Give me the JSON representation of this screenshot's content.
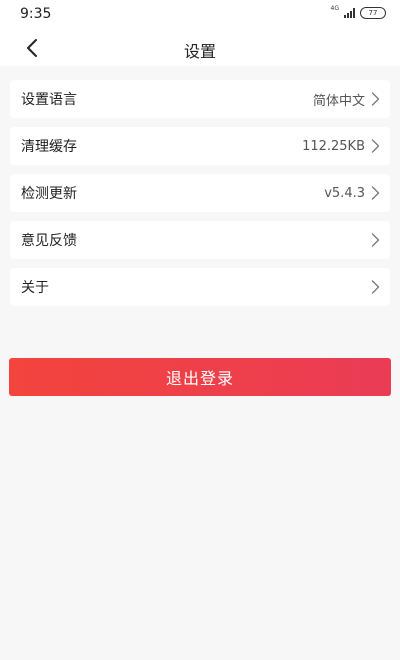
{
  "status_bar": {
    "time": "9:35",
    "network": "4G",
    "battery": "77"
  },
  "header": {
    "title": "设置",
    "back_icon": "chevron-left-icon"
  },
  "settings": {
    "items": [
      {
        "label": "设置语言",
        "value": "简体中文"
      },
      {
        "label": "清理缓存",
        "value": "112.25KB"
      },
      {
        "label": "检测更新",
        "value": "v5.4.3"
      },
      {
        "label": "意见反馈",
        "value": ""
      },
      {
        "label": "关于",
        "value": ""
      }
    ]
  },
  "logout": {
    "label": "退出登录",
    "color_start": "#f3443d",
    "color_end": "#ea3c55"
  }
}
